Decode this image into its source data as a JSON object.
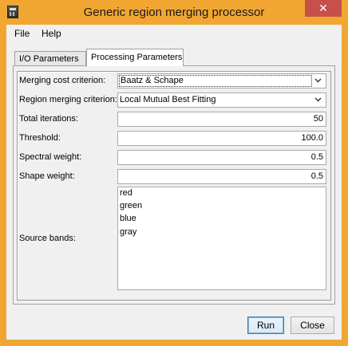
{
  "window": {
    "title": "Generic region merging processor",
    "close_glyph": "✕"
  },
  "menu": {
    "items": [
      "File",
      "Help"
    ]
  },
  "tabs": [
    {
      "label": "I/O Parameters",
      "active": false
    },
    {
      "label": "Processing Parameters",
      "active": true
    }
  ],
  "params": {
    "merging_cost": {
      "label": "Merging cost criterion:",
      "value": "Baatz & Schape"
    },
    "region_merging": {
      "label": "Region merging criterion:",
      "value": "Local Mutual Best Fitting"
    },
    "total_iterations": {
      "label": "Total iterations:",
      "value": "50"
    },
    "threshold": {
      "label": "Threshold:",
      "value": "100.0"
    },
    "spectral_weight": {
      "label": "Spectral weight:",
      "value": "0.5"
    },
    "shape_weight": {
      "label": "Shape weight:",
      "value": "0.5"
    },
    "source_bands": {
      "label": "Source bands:",
      "items": [
        "red",
        "green",
        "blue",
        "gray"
      ]
    }
  },
  "buttons": {
    "run": "Run",
    "close": "Close"
  },
  "icons": {
    "dropdown": "chevron-down-icon",
    "app": "app-icon",
    "close": "close-icon"
  }
}
